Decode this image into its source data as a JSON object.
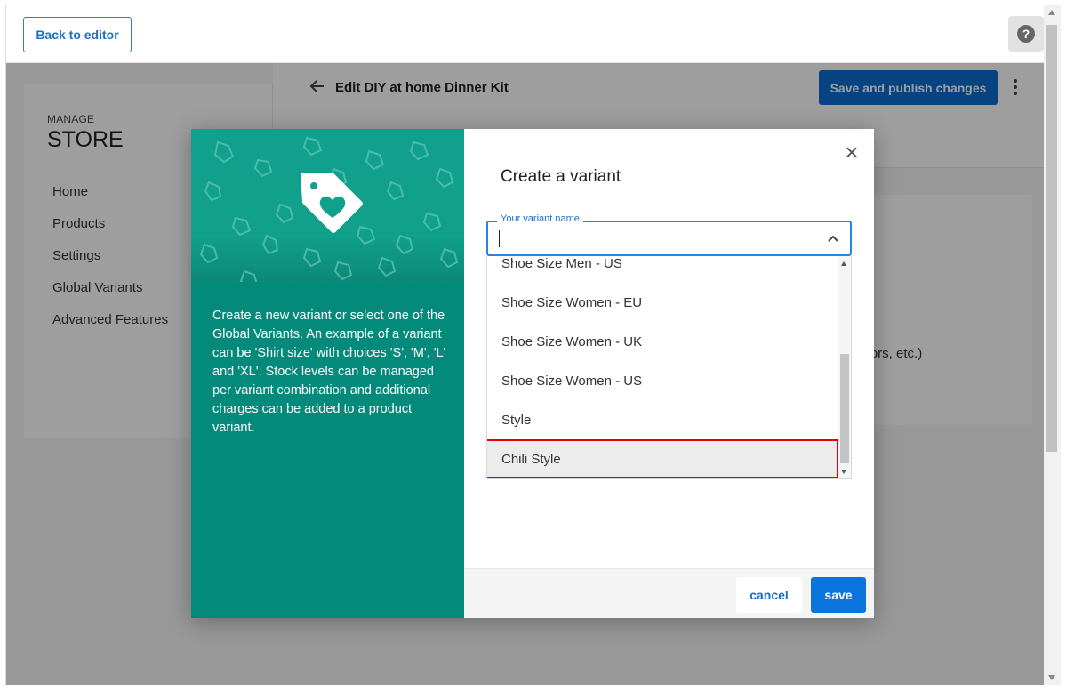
{
  "topbar": {
    "back_label": "Back to editor",
    "help_symbol": "?"
  },
  "sidebar": {
    "manage_label": "MANAGE",
    "store_label": "STORE",
    "items": [
      {
        "label": "Home"
      },
      {
        "label": "Products"
      },
      {
        "label": "Settings"
      },
      {
        "label": "Global Variants"
      },
      {
        "label": "Advanced Features"
      }
    ]
  },
  "editor": {
    "title": "Edit DIY at home Dinner Kit",
    "publish_label": "Save and publish changes",
    "partial_text": "avors, etc.)"
  },
  "modal": {
    "title": "Create a variant",
    "description": "Create a new variant or select one of the Global Variants. An example of a variant can be 'Shirt size' with choices 'S', 'M', 'L' and 'XL'. Stock levels can be managed per variant combination and additional charges can be added to a product variant.",
    "field_label": "Your variant name",
    "field_value": "",
    "options": [
      {
        "label": "Shoe Size Men - US"
      },
      {
        "label": "Shoe Size Women - EU"
      },
      {
        "label": "Shoe Size Women - UK"
      },
      {
        "label": "Shoe Size Women - US"
      },
      {
        "label": "Style"
      },
      {
        "label": "Chili Style"
      }
    ],
    "cancel_label": "cancel",
    "save_label": "save",
    "close_symbol": "×"
  },
  "colors": {
    "accent": "#0b6cd1",
    "modal_panel": "#048a7a",
    "highlight_border": "#e00000"
  },
  "icons": [
    "help-icon",
    "back-arrow-icon",
    "more-vertical-icon",
    "price-tag-heart-icon",
    "close-icon",
    "chevron-up-icon"
  ]
}
